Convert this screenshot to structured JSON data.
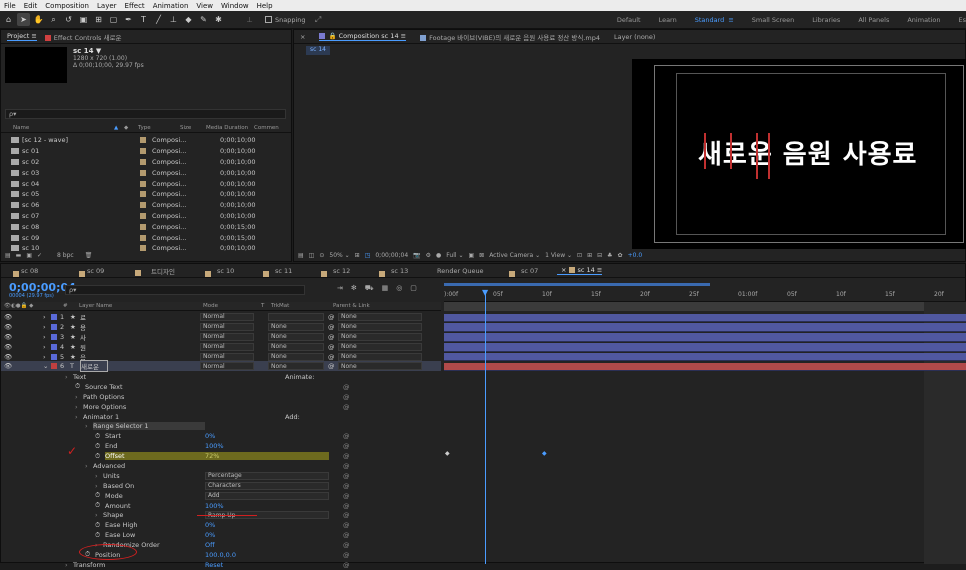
{
  "menu": [
    "File",
    "Edit",
    "Composition",
    "Layer",
    "Effect",
    "Animation",
    "View",
    "Window",
    "Help"
  ],
  "toolbar": {
    "snapping_label": "Snapping",
    "workspaces": [
      "Default",
      "Learn",
      "Standard",
      "Small Screen",
      "Libraries",
      "All Panels",
      "Animation",
      "Es"
    ],
    "active_workspace": "Standard"
  },
  "project": {
    "tab_label": "Project",
    "effect_controls_label": "Effect Controls 새로운",
    "comp_name": "sc 14 ▼",
    "comp_res": "1280 x 720 (1.00)",
    "comp_dur": "Δ 0;00;10;00, 29.97 fps",
    "search_placeholder": "ρ▾",
    "columns": [
      "Name",
      "Type",
      "Size",
      "Media Duration",
      "Commen"
    ],
    "items": [
      {
        "name": "[sc 12 - wave]",
        "type": "Composi...",
        "dur": "0;00;10;00"
      },
      {
        "name": "sc 01",
        "type": "Composi...",
        "dur": "0;00;10;00"
      },
      {
        "name": "sc 02",
        "type": "Composi...",
        "dur": "0;00;10;00"
      },
      {
        "name": "sc 03",
        "type": "Composi...",
        "dur": "0;00;10;00"
      },
      {
        "name": "sc 04",
        "type": "Composi...",
        "dur": "0;00;10;00"
      },
      {
        "name": "sc 05",
        "type": "Composi...",
        "dur": "0;00;10;00"
      },
      {
        "name": "sc 06",
        "type": "Composi...",
        "dur": "0;00;10;00"
      },
      {
        "name": "sc 07",
        "type": "Composi...",
        "dur": "0;00;10;00"
      },
      {
        "name": "sc 08",
        "type": "Composi...",
        "dur": "0;00;15;00"
      },
      {
        "name": "sc 09",
        "type": "Composi...",
        "dur": "0;00;15;00"
      },
      {
        "name": "sc 10",
        "type": "Composi...",
        "dur": "0;00;10;00"
      }
    ],
    "bpc": "8 bpc"
  },
  "viewer": {
    "comp_tab": "Composition sc 14",
    "footage_tab": "Footage 바이브(VIBE)의 새로운 음원 사용료 정산 방식.mp4",
    "layer_tab": "Layer (none)",
    "subtab": "sc 14",
    "canvas_text": "새로운 음원 사용료",
    "zoom": "50%",
    "timecode": "0;00;00;04",
    "quality": "Full",
    "camera": "Active Camera",
    "view": "1 View",
    "exposure": "+0.0"
  },
  "timeline": {
    "tabs": [
      "sc 08",
      "sc 09",
      "트디자인",
      "sc 10",
      "sc 11",
      "sc 12",
      "sc 13",
      "Render Queue",
      "sc 07",
      "sc 14"
    ],
    "active_tab": "sc 14",
    "timecode": "0;00;00;04",
    "fps_sub": "00004 (29.97 fps)",
    "search_placeholder": "ρ▾",
    "col_headers": {
      "num": "#",
      "layer": "Layer Name",
      "mode": "Mode",
      "t": "T",
      "trkmat": "TrkMat",
      "parent": "Parent & Link"
    },
    "ruler": [
      "):00f",
      "05f",
      "10f",
      "15f",
      "20f",
      "25f",
      "01:00f",
      "05f",
      "10f",
      "15f",
      "20f"
    ],
    "layers": [
      {
        "num": "1",
        "name": "료",
        "icon": "★",
        "mode": "Normal",
        "trkmat": "",
        "parent": "None"
      },
      {
        "num": "2",
        "name": "용",
        "icon": "★",
        "mode": "Normal",
        "trkmat": "None",
        "parent": "None"
      },
      {
        "num": "3",
        "name": "사",
        "icon": "★",
        "mode": "Normal",
        "trkmat": "None",
        "parent": "None"
      },
      {
        "num": "4",
        "name": "원",
        "icon": "★",
        "mode": "Normal",
        "trkmat": "None",
        "parent": "None"
      },
      {
        "num": "5",
        "name": "음",
        "icon": "★",
        "mode": "Normal",
        "trkmat": "None",
        "parent": "None"
      },
      {
        "num": "6",
        "name": "새로운",
        "icon": "T",
        "mode": "Normal",
        "trkmat": "None",
        "parent": "None"
      }
    ],
    "props": [
      {
        "label": "Text",
        "indent": 1,
        "value": "",
        "extra": "Animate:"
      },
      {
        "label": "Source Text",
        "indent": 2,
        "value": "",
        "stop": true
      },
      {
        "label": "Path Options",
        "indent": 2,
        "value": ""
      },
      {
        "label": "More Options",
        "indent": 2,
        "value": ""
      },
      {
        "label": "Animator 1",
        "indent": 2,
        "value": "",
        "extra": "Add:"
      },
      {
        "label": "Range Selector 1",
        "indent": 3,
        "value": "",
        "hl": true
      },
      {
        "label": "Start",
        "indent": 4,
        "value": "0%",
        "stop": true
      },
      {
        "label": "End",
        "indent": 4,
        "value": "100%",
        "stop": true
      },
      {
        "label": "Offset",
        "indent": 4,
        "value": "72%",
        "stop": true,
        "yellow": true
      },
      {
        "label": "Advanced",
        "indent": 3,
        "value": ""
      },
      {
        "label": "Units",
        "indent": 4,
        "value": "Percentage",
        "dd": true
      },
      {
        "label": "Based On",
        "indent": 4,
        "value": "Characters",
        "dd": true
      },
      {
        "label": "Mode",
        "indent": 4,
        "value": "Add",
        "dd": true,
        "stop": true
      },
      {
        "label": "Amount",
        "indent": 4,
        "value": "100%",
        "stop": true
      },
      {
        "label": "Shape",
        "indent": 4,
        "value": "Ramp Up",
        "dd": true
      },
      {
        "label": "Ease High",
        "indent": 4,
        "value": "0%",
        "stop": true
      },
      {
        "label": "Ease Low",
        "indent": 4,
        "value": "0%",
        "stop": true
      },
      {
        "label": "Randomize Order",
        "indent": 4,
        "value": "Off"
      },
      {
        "label": "Position",
        "indent": 3,
        "value": "100.0,0.0",
        "stop": true
      },
      {
        "label": "Transform",
        "indent": 1,
        "value": "Reset"
      }
    ]
  }
}
